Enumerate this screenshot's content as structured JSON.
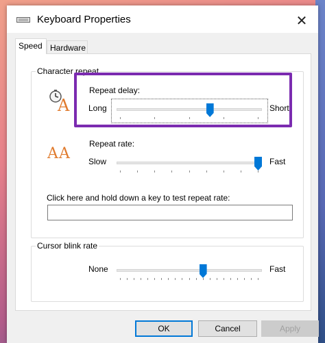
{
  "window": {
    "title": "Keyboard Properties",
    "close_symbol": "✕"
  },
  "tabs": [
    {
      "label": "Speed",
      "active": true
    },
    {
      "label": "Hardware",
      "active": false
    }
  ],
  "character_repeat": {
    "group_title": "Character repeat",
    "repeat_delay": {
      "label": "Repeat delay:",
      "min_label": "Long",
      "max_label": "Short",
      "level": 0.65
    },
    "repeat_rate": {
      "label": "Repeat rate:",
      "min_label": "Slow",
      "max_label": "Fast",
      "level": 1.0
    },
    "test_label": "Click here and hold down a key to test repeat rate:",
    "test_value": ""
  },
  "cursor_blink": {
    "group_title": "Cursor blink rate",
    "min_label": "None",
    "max_label": "Fast",
    "level": 0.6
  },
  "buttons": {
    "ok": "OK",
    "cancel": "Cancel",
    "apply": "Apply"
  },
  "colors": {
    "accent": "#0078d7",
    "highlight_box": "#7b2bb0"
  },
  "icons": [
    "keyboard-icon",
    "repeat-delay-clock-icon",
    "repeat-rate-aa-icon",
    "close-icon"
  ]
}
